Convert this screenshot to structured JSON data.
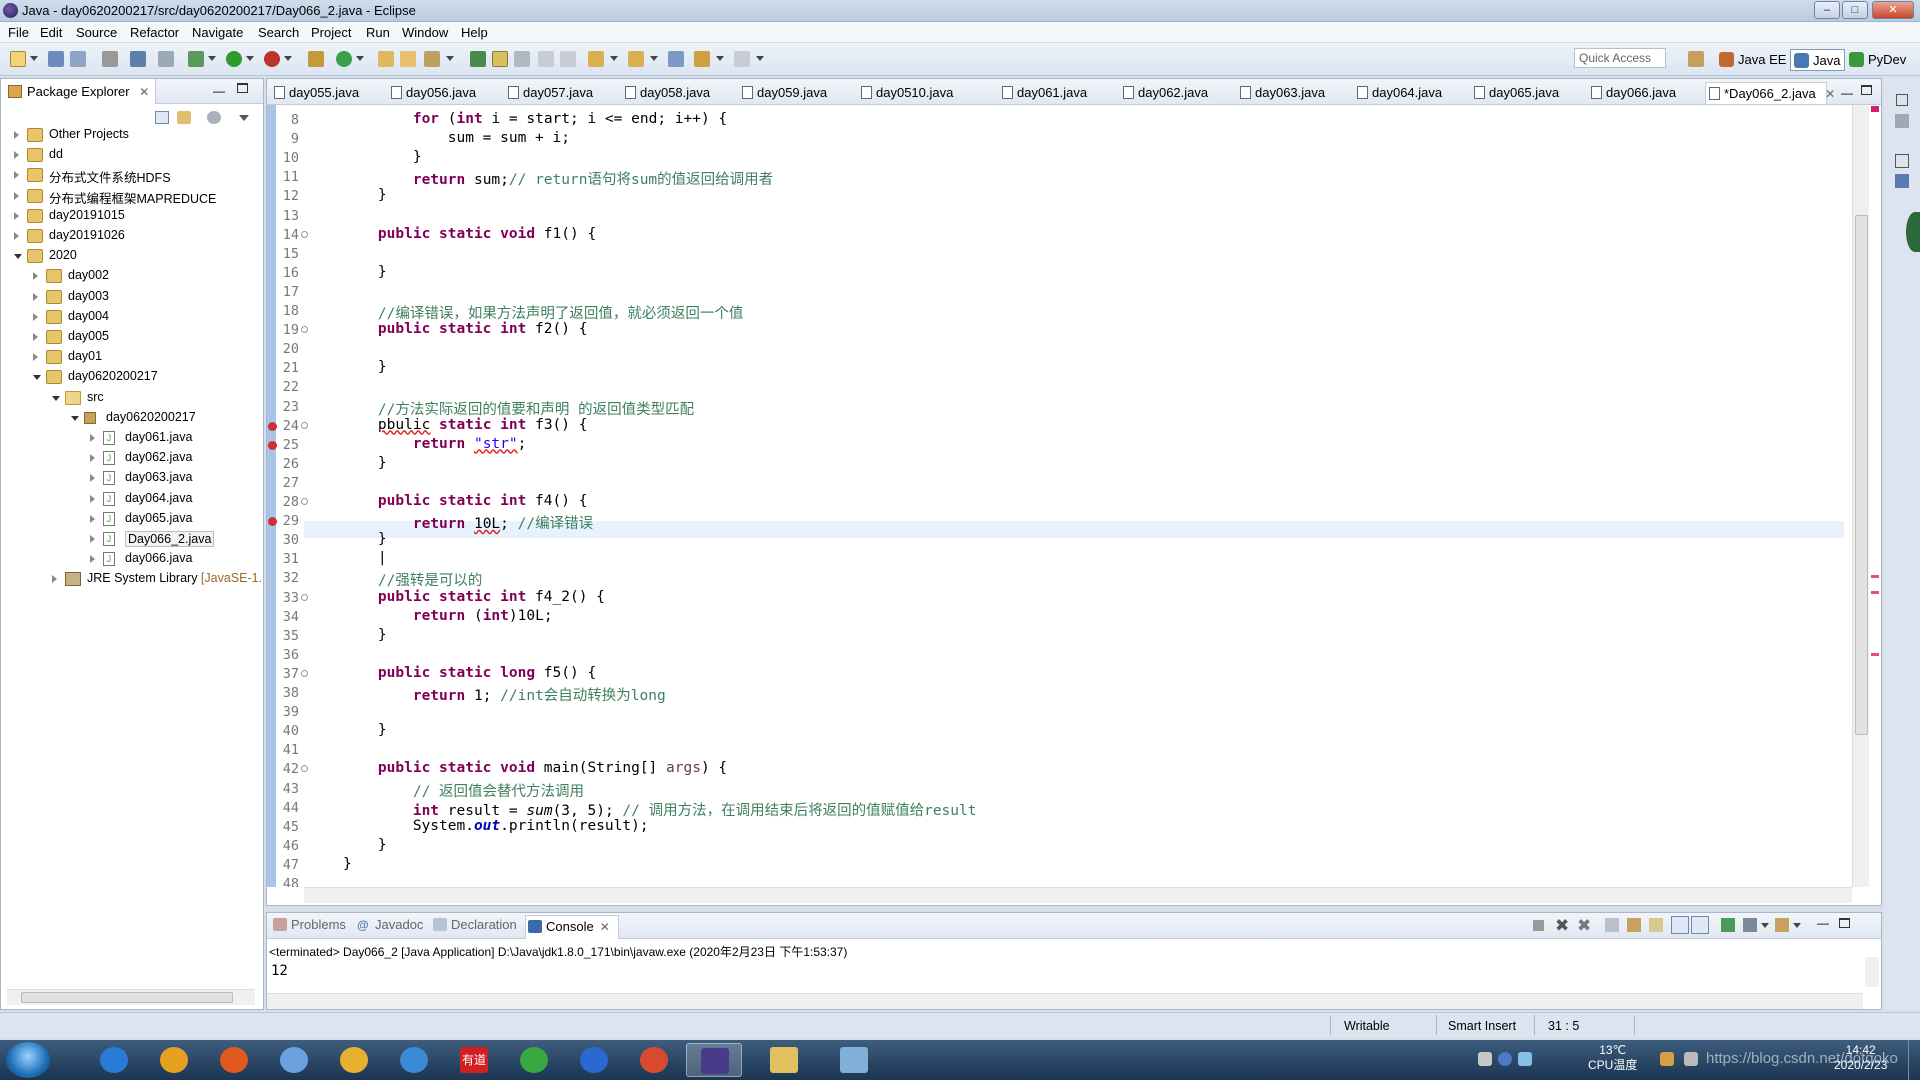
{
  "window": {
    "title": "Java - day0620200217/src/day0620200217/Day066_2.java - Eclipse",
    "buttons": [
      "–",
      "□",
      "✕"
    ]
  },
  "menubar": [
    "File",
    "Edit",
    "Source",
    "Refactor",
    "Navigate",
    "Search",
    "Project",
    "Run",
    "Window",
    "Help"
  ],
  "toolbar": {
    "quick_access": "Quick Access",
    "perspectives": [
      "Java EE",
      "Java",
      "PyDev"
    ]
  },
  "package_explorer": {
    "title": "Package Explorer",
    "items": [
      {
        "label": "Other Projects",
        "depth": 0,
        "icon": "project-icon",
        "expanded": false
      },
      {
        "label": "dd",
        "depth": 0,
        "icon": "project-icon",
        "expanded": false
      },
      {
        "label": "分布式文件系统HDFS",
        "depth": 0,
        "icon": "project-icon",
        "expanded": false
      },
      {
        "label": "分布式编程框架MAPREDUCE",
        "depth": 0,
        "icon": "project-icon",
        "expanded": false
      },
      {
        "label": "day20191015",
        "depth": 0,
        "icon": "project-icon",
        "expanded": false
      },
      {
        "label": "day20191026",
        "depth": 0,
        "icon": "project-icon",
        "expanded": false
      },
      {
        "label": "2020",
        "depth": 0,
        "icon": "project-icon",
        "expanded": true
      },
      {
        "label": "day002",
        "depth": 1,
        "icon": "project-icon",
        "expanded": false
      },
      {
        "label": "day003",
        "depth": 1,
        "icon": "project-icon",
        "expanded": false
      },
      {
        "label": "day004",
        "depth": 1,
        "icon": "project-icon",
        "expanded": false
      },
      {
        "label": "day005",
        "depth": 1,
        "icon": "project-icon",
        "expanded": false
      },
      {
        "label": "day01",
        "depth": 1,
        "icon": "project-icon",
        "expanded": false
      },
      {
        "label": "day0620200217",
        "depth": 1,
        "icon": "project-icon",
        "expanded": true
      },
      {
        "label": "src",
        "depth": 2,
        "icon": "folder-icon",
        "expanded": true
      },
      {
        "label": "day0620200217",
        "depth": 3,
        "icon": "package-icon",
        "expanded": true
      },
      {
        "label": "day061.java",
        "depth": 4,
        "icon": "java-file-icon",
        "expanded": false
      },
      {
        "label": "day062.java",
        "depth": 4,
        "icon": "java-file-icon",
        "expanded": false
      },
      {
        "label": "day063.java",
        "depth": 4,
        "icon": "java-file-icon",
        "expanded": false
      },
      {
        "label": "day064.java",
        "depth": 4,
        "icon": "java-file-icon",
        "expanded": false
      },
      {
        "label": "day065.java",
        "depth": 4,
        "icon": "java-file-icon",
        "expanded": false
      },
      {
        "label": "Day066_2.java",
        "depth": 4,
        "icon": "java-file-icon",
        "expanded": false,
        "selected": true
      },
      {
        "label": "day066.java",
        "depth": 4,
        "icon": "java-file-icon",
        "expanded": false
      },
      {
        "label": "JRE System Library [JavaSE-1.",
        "depth": 2,
        "icon": "library-icon",
        "expanded": false
      }
    ]
  },
  "editor": {
    "tabs": [
      "day055.java",
      "day056.java",
      "day057.java",
      "day058.java",
      "day059.java",
      "day0510.java",
      "day061.java",
      "day062.java",
      "day063.java",
      "day064.java",
      "day065.java",
      "day066.java",
      "*Day066_2.java"
    ],
    "active_tab": "*Day066_2.java",
    "lines": [
      {
        "n": "8",
        "html": "        <span class=\"kw\">for</span> (<span class=\"kw\">int</span> i = start; i &lt;= end; i++) {"
      },
      {
        "n": "9",
        "html": "            sum = sum + i;"
      },
      {
        "n": "10",
        "html": "        }"
      },
      {
        "n": "11",
        "html": "        <span class=\"kw\">return</span> sum;<span class=\"cm\">// return语句将sum的值返回给调用者</span>"
      },
      {
        "n": "12",
        "html": "    }"
      },
      {
        "n": "13",
        "html": ""
      },
      {
        "n": "14",
        "html": "    <span class=\"kw\">public static void</span> f1() {"
      },
      {
        "n": "15",
        "html": ""
      },
      {
        "n": "16",
        "html": "    }"
      },
      {
        "n": "17",
        "html": ""
      },
      {
        "n": "18",
        "html": "    <span class=\"cm\">//编译错误，如果方法声明了返回值，就必须返回一个值</span>"
      },
      {
        "n": "19",
        "html": "    <span class=\"kw\">public static int</span> f2() {"
      },
      {
        "n": "20",
        "html": ""
      },
      {
        "n": "21",
        "html": "    }"
      },
      {
        "n": "22",
        "html": ""
      },
      {
        "n": "23",
        "html": "    <span class=\"cm\">//方法实际返回的值要和声明 的返回值类型匹配</span>"
      },
      {
        "n": "24",
        "html": "    <span class=\"err\">pbulic</span> <span class=\"kw\">static int</span> f3() {"
      },
      {
        "n": "25",
        "html": "        <span class=\"kw\">return</span> <span class=\"str err\">\"str\"</span>;"
      },
      {
        "n": "26",
        "html": "    }"
      },
      {
        "n": "27",
        "html": ""
      },
      {
        "n": "28",
        "html": "    <span class=\"kw\">public static int</span> f4() {"
      },
      {
        "n": "29",
        "html": "        <span class=\"kw\">return</span> <span class=\"err\">10L</span>; <span class=\"cm\">//编译错误</span>"
      },
      {
        "n": "30",
        "html": "    }"
      },
      {
        "n": "31",
        "html": "    |"
      },
      {
        "n": "32",
        "html": "    <span class=\"cm\">//强转是可以的</span>"
      },
      {
        "n": "33",
        "html": "    <span class=\"kw\">public static int</span> f4_2() {"
      },
      {
        "n": "34",
        "html": "        <span class=\"kw\">return</span> (<span class=\"kw\">int</span>)10L;"
      },
      {
        "n": "35",
        "html": "    }"
      },
      {
        "n": "36",
        "html": ""
      },
      {
        "n": "37",
        "html": "    <span class=\"kw\">public static long</span> f5() {"
      },
      {
        "n": "38",
        "html": "        <span class=\"kw\">return</span> 1; <span class=\"cm\">//int会自动转换为long</span>"
      },
      {
        "n": "39",
        "html": ""
      },
      {
        "n": "40",
        "html": "    }"
      },
      {
        "n": "41",
        "html": ""
      },
      {
        "n": "42",
        "html": "    <span class=\"kw\">public static void</span> main(String[] <span class=\"param\">args</span>) {"
      },
      {
        "n": "43",
        "html": "        <span class=\"cm\">// 返回值会替代方法调用</span>"
      },
      {
        "n": "44",
        "html": "        <span class=\"kw\">int</span> result = <span class=\"it\">sum</span>(3, 5); <span class=\"cm\">// 调用方法，在调用结束后将返回的值赋值给result</span>"
      },
      {
        "n": "45",
        "html": "        System.<span class=\"fld\">out</span>.println(result);"
      },
      {
        "n": "46",
        "html": "    }"
      },
      {
        "n": "47",
        "html": "}"
      },
      {
        "n": "48",
        "html": ""
      }
    ]
  },
  "console": {
    "tabs": [
      "Problems",
      "Javadoc",
      "Declaration",
      "Console"
    ],
    "active_tab": "Console",
    "header": "<terminated> Day066_2 [Java Application] D:\\Java\\jdk1.8.0_171\\bin\\javaw.exe (2020年2月23日 下午1:53:37)",
    "output": "12"
  },
  "statusbar": {
    "mode": "Writable",
    "insert": "Smart Insert",
    "position": "31 : 5"
  },
  "taskbar": {
    "temp": "13℃",
    "temp_label": "CPU温度",
    "time": "14:42",
    "date": "2020/2/23",
    "watermark": "https://blog.csdn.net/dotqoko",
    "apps": [
      "ie-icon",
      "media-icon",
      "firefox-icon",
      "app-icon",
      "chrome-color-icon",
      "cloud-icon",
      "youdao-icon",
      "transfer-icon",
      "ie-alt-icon",
      "chrome-icon",
      "eclipse-icon",
      "explorer-icon",
      "notes-icon"
    ],
    "youdao_label": "有道"
  }
}
